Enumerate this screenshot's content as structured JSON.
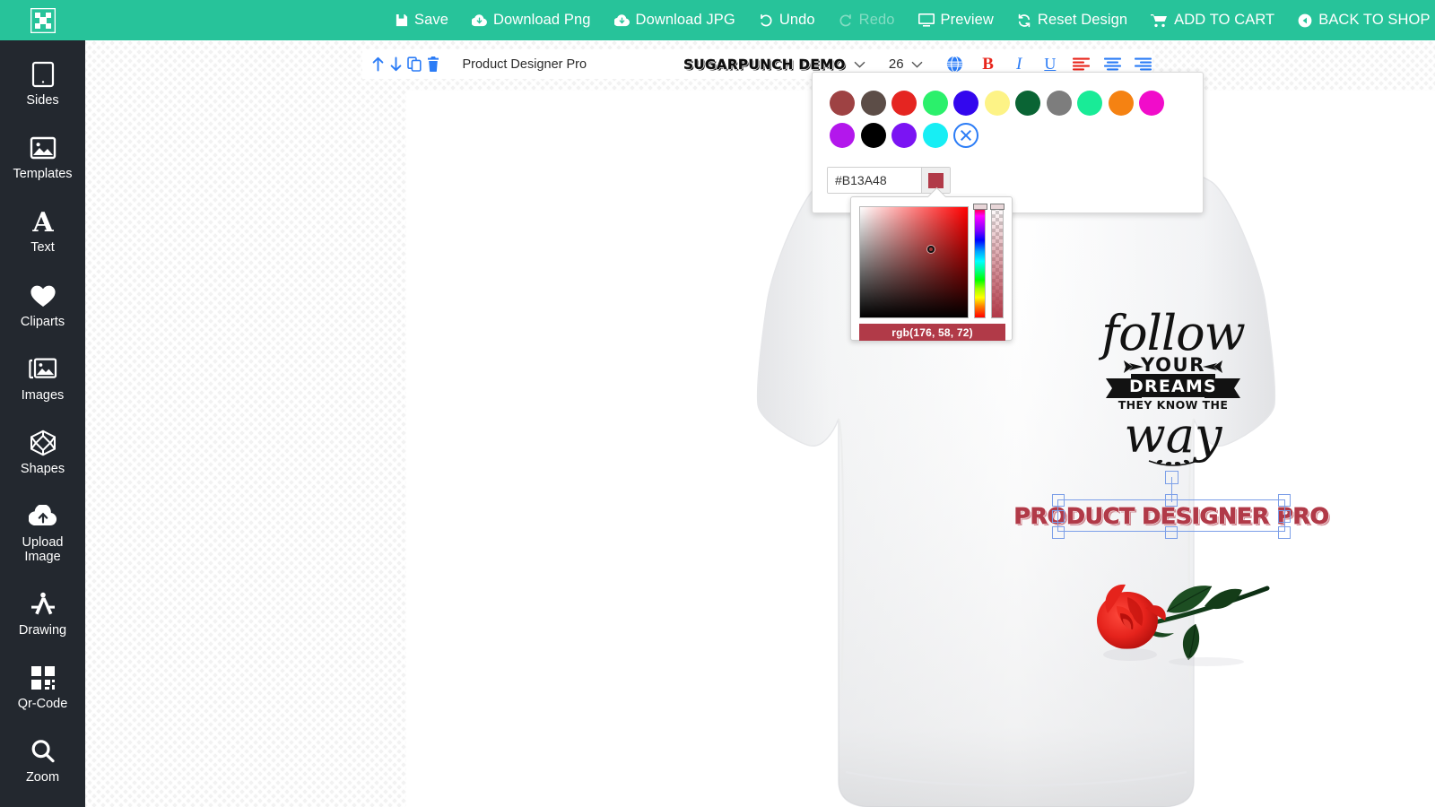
{
  "app": {
    "brand_color": "#27c39a",
    "sidebar_bg": "#23282f",
    "accent_blue": "#2b7cf6",
    "accent_red": "#e8261c"
  },
  "topbar": {
    "logo_name": "product-designer-logo",
    "actions": [
      {
        "label": "Save",
        "icon": "save-icon",
        "disabled": false
      },
      {
        "label": "Download Png",
        "icon": "download-icon",
        "disabled": false
      },
      {
        "label": "Download JPG",
        "icon": "download-icon",
        "disabled": false
      },
      {
        "label": "Undo",
        "icon": "undo-icon",
        "disabled": false
      },
      {
        "label": "Redo",
        "icon": "redo-icon",
        "disabled": true
      },
      {
        "label": "Preview",
        "icon": "monitor-icon",
        "disabled": false
      },
      {
        "label": "Reset Design",
        "icon": "refresh-icon",
        "disabled": false
      },
      {
        "label": "ADD TO CART",
        "icon": "cart-icon",
        "disabled": false
      },
      {
        "label": "BACK TO SHOP",
        "icon": "back-arrow-icon",
        "disabled": false
      }
    ]
  },
  "sidebar": {
    "items": [
      {
        "label": "Sides",
        "label2": "",
        "icon": "tablet-icon"
      },
      {
        "label": "Templates",
        "label2": "",
        "icon": "picture-icon"
      },
      {
        "label": "Text",
        "label2": "",
        "icon": "letter-a-icon"
      },
      {
        "label": "Cliparts",
        "label2": "",
        "icon": "heart-icon"
      },
      {
        "label": "Images",
        "label2": "",
        "icon": "images-stack-icon"
      },
      {
        "label": "Shapes",
        "label2": "",
        "icon": "cube-icon"
      },
      {
        "label": "Upload",
        "label2": "Image",
        "icon": "cloud-upload-icon"
      },
      {
        "label": "Drawing",
        "label2": "",
        "icon": "compass-draw-icon"
      },
      {
        "label": "Qr-Code",
        "label2": "",
        "icon": "qr-code-icon"
      },
      {
        "label": "Zoom",
        "label2": "",
        "icon": "magnifier-icon"
      }
    ]
  },
  "text_toolbar": {
    "layer_up_icon": "arrow-up-icon",
    "layer_down_icon": "arrow-down-icon",
    "duplicate_icon": "copy-icon",
    "delete_icon": "trash-icon",
    "text_value": "Product Designer Pro",
    "font_family_label": "SUGARPUNCH DEMO",
    "font_size_value": "26",
    "color_icon": "globe-color-icon",
    "bold_label": "B",
    "italic_label": "I",
    "underline_label": "U",
    "align_left_icon": "align-left-icon",
    "align_center_icon": "align-center-icon",
    "align_right_icon": "align-right-icon"
  },
  "color_panel": {
    "swatches": [
      "#9e4243",
      "#5c4d47",
      "#e52521",
      "#2bf06b",
      "#3307ee",
      "#fdf386",
      "#0a6434",
      "#7d7d7d",
      "#19eb97",
      "#f58212",
      "#f10cca",
      "#b317ec",
      "#000000",
      "#7b14f3",
      "#17eef4"
    ],
    "no_color_label": "none",
    "hex_value": "#B13A48",
    "preview_color": "#b13a48",
    "spectrum": {
      "readout": "rgb(176, 58, 72)",
      "selected_color": "#b13a48",
      "hue_position": "top",
      "alpha_position": "top"
    }
  },
  "canvas": {
    "design_texts": {
      "follow": "follow",
      "your": "YOUR",
      "dreams": "DREAMS",
      "they_know_the": "THEY KNOW THE",
      "way": "way"
    },
    "selected_object_text": "PRODUCT DESIGNER PRO",
    "selected_object_color": "#b13a48",
    "clipart_name": "red-rose-clipart",
    "product_name": "white-t-shirt-front"
  }
}
